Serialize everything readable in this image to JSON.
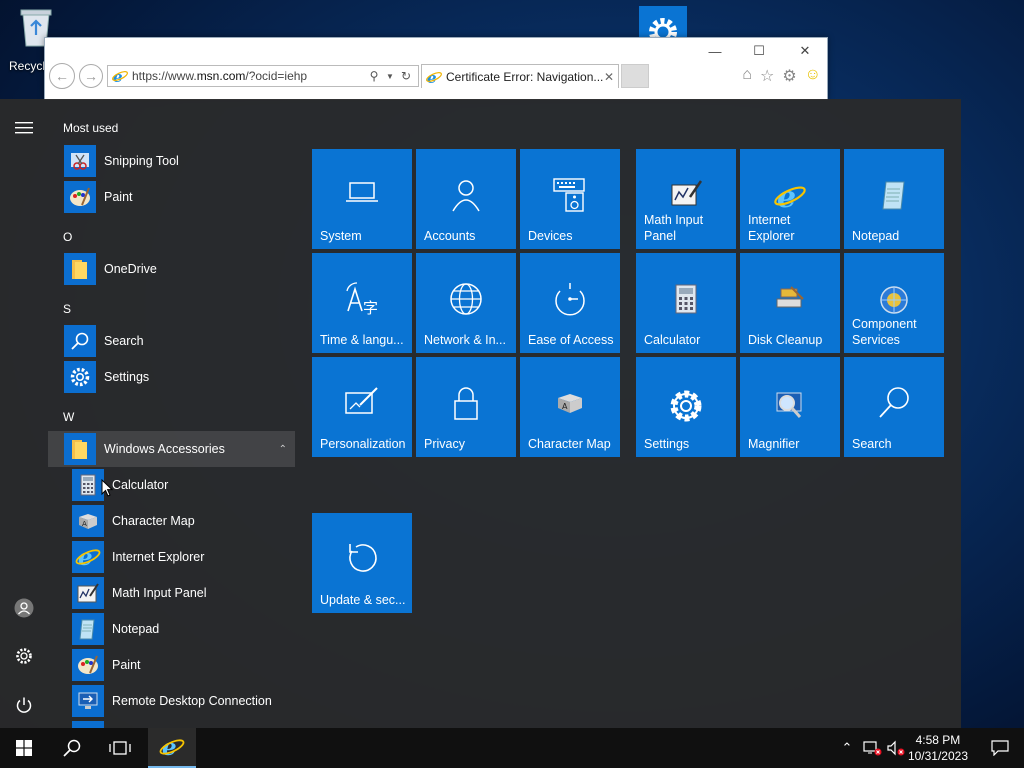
{
  "desktop": {
    "recycle_bin_label": "Recycle Bin"
  },
  "ie": {
    "url_host": "https://www.",
    "url_domain": "msn.com",
    "url_path": "/?ocid=iehp",
    "tab_title": "Certificate Error: Navigation..."
  },
  "start": {
    "most_used_label": "Most used",
    "most_used": [
      {
        "label": "Snipping Tool",
        "icon": "scissors-icon"
      },
      {
        "label": "Paint",
        "icon": "palette-icon"
      }
    ],
    "sections": [
      {
        "letter": "O",
        "items": [
          {
            "label": "OneDrive",
            "icon": "folder-icon"
          }
        ]
      },
      {
        "letter": "S",
        "items": [
          {
            "label": "Search",
            "icon": "search-icon"
          },
          {
            "label": "Settings",
            "icon": "gear-icon"
          }
        ]
      },
      {
        "letter": "W",
        "items": [
          {
            "label": "Windows Accessories",
            "icon": "folder-icon"
          }
        ]
      }
    ],
    "accessories": [
      {
        "label": "Calculator"
      },
      {
        "label": "Character Map"
      },
      {
        "label": "Internet Explorer"
      },
      {
        "label": "Math Input Panel"
      },
      {
        "label": "Notepad"
      },
      {
        "label": "Paint"
      },
      {
        "label": "Remote Desktop Connection"
      }
    ],
    "tiles": [
      {
        "label": "System",
        "icon": "laptop-icon"
      },
      {
        "label": "Accounts",
        "icon": "person-icon"
      },
      {
        "label": "Devices",
        "icon": "keyboard-speaker-icon"
      },
      {
        "label": "Math Input Panel",
        "icon": "math-input-icon"
      },
      {
        "label": "Internet Explorer",
        "icon": "ie-icon"
      },
      {
        "label": "Notepad",
        "icon": "notepad-icon"
      },
      {
        "label": "Time & langu...",
        "icon": "time-language-icon"
      },
      {
        "label": "Network & In...",
        "icon": "globe-icon"
      },
      {
        "label": "Ease of Access",
        "icon": "ease-of-access-icon"
      },
      {
        "label": "Calculator",
        "icon": "calculator-icon"
      },
      {
        "label": "Disk Cleanup",
        "icon": "disk-cleanup-icon"
      },
      {
        "label": "Component Services",
        "icon": "component-services-icon"
      },
      {
        "label": "Personalization",
        "icon": "personalization-icon"
      },
      {
        "label": "Privacy",
        "icon": "lock-icon"
      },
      {
        "label": "Character Map",
        "icon": "character-map-icon"
      },
      {
        "label": "Settings",
        "icon": "gear-icon"
      },
      {
        "label": "Magnifier",
        "icon": "magnifier-icon"
      },
      {
        "label": "Search",
        "icon": "search-icon"
      },
      {
        "label": "Update & sec...",
        "icon": "update-icon"
      }
    ]
  },
  "taskbar": {
    "time": "4:58 PM",
    "date": "10/31/2023"
  },
  "colors": {
    "tile_blue": "#0a74d3",
    "start_bg": "#2b2b2b",
    "taskbar_bg": "#101010"
  }
}
